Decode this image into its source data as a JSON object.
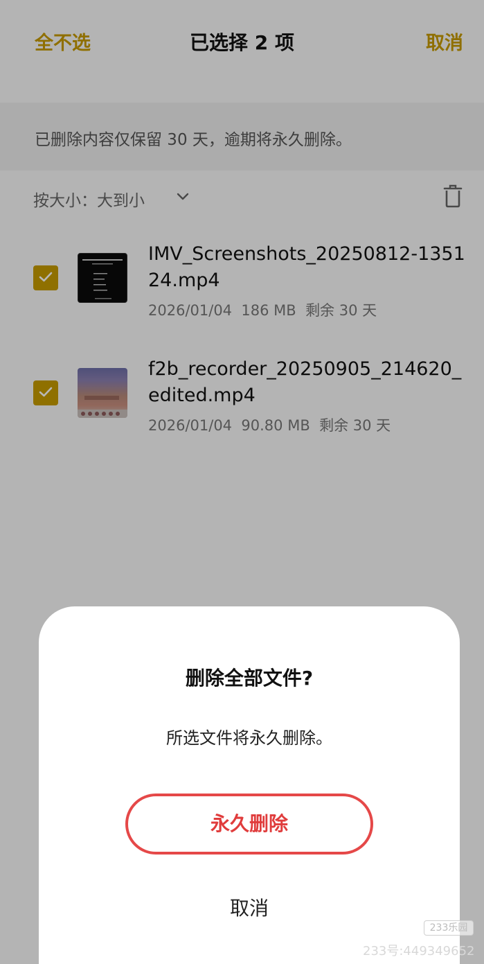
{
  "header": {
    "deselect_all": "全不选",
    "title": "已选择 2 项",
    "cancel": "取消"
  },
  "notice": "已删除内容仅保留 30 天，逾期将永久删除。",
  "sort": {
    "label": "按大小：大到小",
    "chevron_icon": "chevron-down-icon",
    "trash_icon": "trash-icon"
  },
  "files": [
    {
      "name": "IMV_Screenshots_20250812-135124.mp4",
      "date": "2026/01/04",
      "size": "186 MB",
      "remaining": "剩余 30 天",
      "checked": true
    },
    {
      "name": "f2b_recorder_20250905_214620_edited.mp4",
      "date": "2026/01/04",
      "size": "90.80 MB",
      "remaining": "剩余 30 天",
      "checked": true
    }
  ],
  "dialog": {
    "title": "删除全部文件?",
    "message": "所选文件将永久删除。",
    "confirm": "永久删除",
    "cancel": "取消"
  },
  "watermark": {
    "logo": "233乐园",
    "id": "233号:449349652"
  },
  "colors": {
    "accent": "#c69c00",
    "danger": "#e03c3c"
  }
}
